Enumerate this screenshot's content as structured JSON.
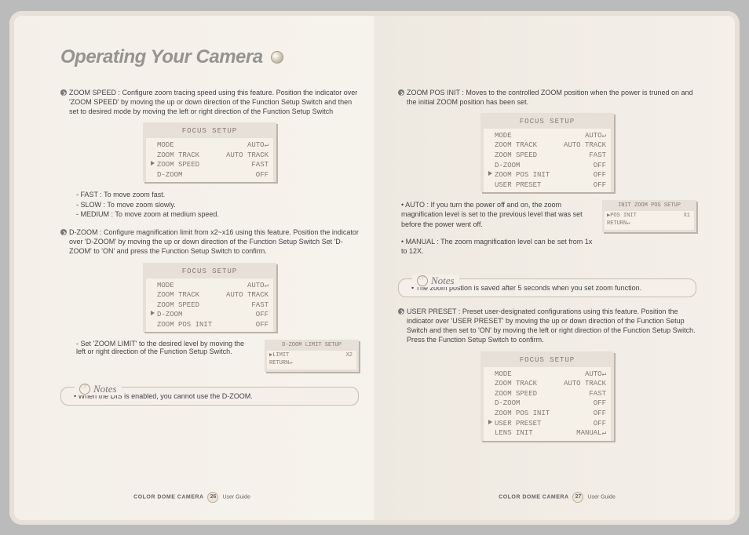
{
  "title": "Operating Your Camera",
  "left": {
    "zoomspeed": {
      "label": "ZOOM SPEED :",
      "text": "Configure zoom tracing speed using this feature. Position the indicator over 'ZOOM SPEED' by moving the up or down direction of the Function Setup Switch and then set to desired mode by moving the left or right direction of the Function Setup Switch"
    },
    "panel1": {
      "title": "FOCUS SETUP",
      "rows": [
        {
          "l": "MODE",
          "r": "AUTO↵"
        },
        {
          "l": "ZOOM TRACK",
          "r": "AUTO TRACK"
        },
        {
          "l": "ZOOM SPEED",
          "r": "FAST",
          "sel": true
        },
        {
          "l": "D-ZOOM",
          "r": "OFF"
        }
      ]
    },
    "speedopts": [
      "- FAST : To move zoom fast.",
      "- SLOW : To move zoom slowly.",
      "- MEDIUM : To move zoom at medium speed."
    ],
    "dzoom": {
      "label": "D-ZOOM :",
      "text": "Configure magnification limit from x2~x16 using this feature. Position the indicator over 'D-ZOOM' by moving the up or down direction of the Function Setup Switch Set 'D-ZOOM' to 'ON' and press the Function Setup Switch to confirm."
    },
    "panel2": {
      "title": "FOCUS SETUP",
      "rows": [
        {
          "l": "MODE",
          "r": "AUTO↵"
        },
        {
          "l": "ZOOM TRACK",
          "r": "AUTO TRACK"
        },
        {
          "l": "ZOOM SPEED",
          "r": "FAST"
        },
        {
          "l": "D-ZOOM",
          "r": "OFF",
          "sel": true
        },
        {
          "l": "ZOOM POS INIT",
          "r": "OFF"
        }
      ]
    },
    "zoomlimit_text": "- Set 'ZOOM LIMIT' to the desired level by moving the left or right direction of the Function Setup Switch.",
    "mini1": {
      "title": "D-ZOOM LIMIT SETUP",
      "rows": [
        {
          "l": "▶LIMIT",
          "r": "X2"
        },
        {
          "l": "RETURN↵",
          "r": ""
        }
      ]
    },
    "note_label": "Notes",
    "note1": "• When the DIS is enabled, you cannot use the D-ZOOM."
  },
  "right": {
    "posinit": {
      "label": "ZOOM POS INIT :",
      "text": "Moves to the controlled ZOOM position when the power is truned on and the initial ZOOM position has been set."
    },
    "panel3": {
      "title": "FOCUS SETUP",
      "rows": [
        {
          "l": "MODE",
          "r": "AUTO↵"
        },
        {
          "l": "ZOOM TRACK",
          "r": "AUTO TRACK"
        },
        {
          "l": "ZOOM SPEED",
          "r": "FAST"
        },
        {
          "l": "D-ZOOM",
          "r": "OFF"
        },
        {
          "l": "ZOOM POS INIT",
          "r": "OFF",
          "sel": true
        },
        {
          "l": "USER PRESET",
          "r": "OFF"
        }
      ]
    },
    "auto": {
      "label": "• AUTO :",
      "text": "If you turn the power off and on, the zoom magnification level is set to the previous level that was set before the power went off."
    },
    "manual": {
      "label": "• MANUAL :",
      "text": "The zoom magnification level can be set from 1x to 12X."
    },
    "mini2": {
      "title": "INIT ZOOM POS SETUP",
      "rows": [
        {
          "l": "▶POS INIT",
          "r": "X1"
        },
        {
          "l": "RETURN↵",
          "r": ""
        }
      ]
    },
    "note_label": "Notes",
    "note2": "• The zoom postion is saved after 5 seconds when you set zoom function.",
    "userpreset": {
      "label": "USER PRESET :",
      "text": "Preset user-designated configurations using this feature. Position the indicator over 'USER PRESET' by moving the up or down direction of the Function Setup Switch and then set to 'ON' by moving the left or right direction of the Function Setup Switch. Press the Function Setup Switch to confirm."
    },
    "panel4": {
      "title": "FOCUS SETUP",
      "rows": [
        {
          "l": "MODE",
          "r": "AUTO↵"
        },
        {
          "l": "ZOOM TRACK",
          "r": "AUTO TRACK"
        },
        {
          "l": "ZOOM SPEED",
          "r": "FAST"
        },
        {
          "l": "D-ZOOM",
          "r": "OFF"
        },
        {
          "l": "ZOOM POS INIT",
          "r": "OFF"
        },
        {
          "l": "USER PRESET",
          "r": "OFF",
          "sel": true
        },
        {
          "l": "LENS INIT",
          "r": "MANUAL↵"
        }
      ]
    }
  },
  "footer": {
    "product": "COLOR DOME CAMERA",
    "guide": "User Guide",
    "page_left": "26",
    "page_right": "27"
  }
}
